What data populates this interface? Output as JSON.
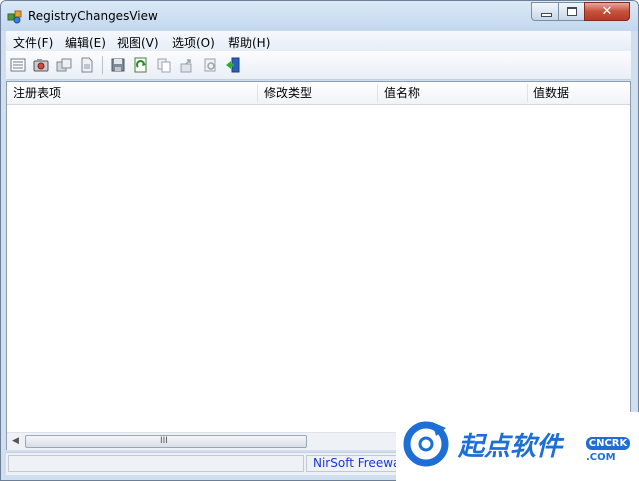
{
  "window": {
    "title": "RegistryChangesView",
    "buttons": {
      "minimize": "minimize-icon",
      "maximize": "maximize-icon",
      "close": "close-icon"
    }
  },
  "menu": [
    {
      "label": "文件(F)"
    },
    {
      "label": "编辑(E)"
    },
    {
      "label": "视图(V)"
    },
    {
      "label": "选项(O)"
    },
    {
      "label": "帮助(H)"
    }
  ],
  "toolbar": {
    "icons": [
      "list-view-icon",
      "snapshot-camera-icon",
      "compare-snapshots-icon",
      "load-file-icon",
      "save-icon",
      "refresh-icon",
      "copy-icon",
      "export-icon",
      "properties-icon",
      "exit-icon"
    ]
  },
  "table": {
    "columns": [
      {
        "label": "注册表项"
      },
      {
        "label": "修改类型"
      },
      {
        "label": "值名称"
      },
      {
        "label": "值数据"
      }
    ],
    "rows": []
  },
  "scrollbar": {
    "grip": "III"
  },
  "status": {
    "text": "NirSoft Freewa"
  },
  "watermark": {
    "text": "起点软件",
    "badge": "CNCRK",
    "domain": ".COM"
  },
  "colors": {
    "accent": "#1a37d8",
    "watermark": "#1d6fd6",
    "close_button": "#c4523c"
  }
}
